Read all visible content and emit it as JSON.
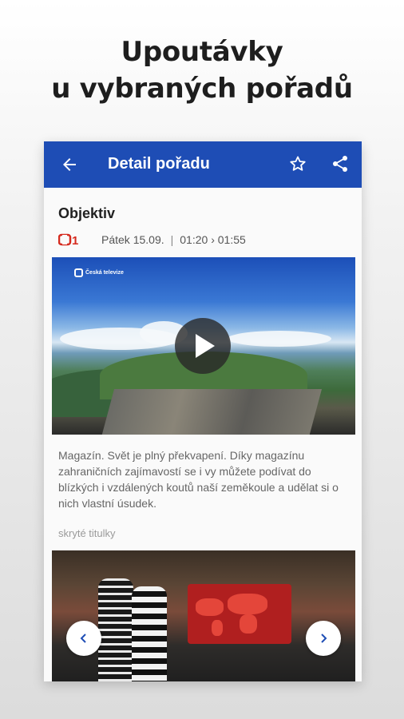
{
  "headline": {
    "line1": "Upoutávky",
    "line2": "u vybraných pořadů"
  },
  "appbar": {
    "title": "Detail pořadu",
    "back_icon": "arrow-left-icon",
    "favorite_icon": "star-outline-icon",
    "share_icon": "share-icon",
    "color": "#1e4db5"
  },
  "show": {
    "title": "Objektiv",
    "channel_logo": "ČT1",
    "date": "Pátek 15.09.",
    "separator": "|",
    "time": "01:20 › 01:55",
    "description": "Magazín. Svět je plný překvapení. Díky magazínu zahraničních zajímavostí se i vy můžete podívat do blízkých i vzdálených koutů naší zeměkoule a udělat si o nich vlastní úsudek.",
    "subtitles_label": "skryté titulky"
  },
  "video": {
    "watermark": "Česká televize",
    "play_icon": "play-icon"
  },
  "gallery": {
    "prev_icon": "chevron-left-icon",
    "next_icon": "chevron-right-icon"
  }
}
